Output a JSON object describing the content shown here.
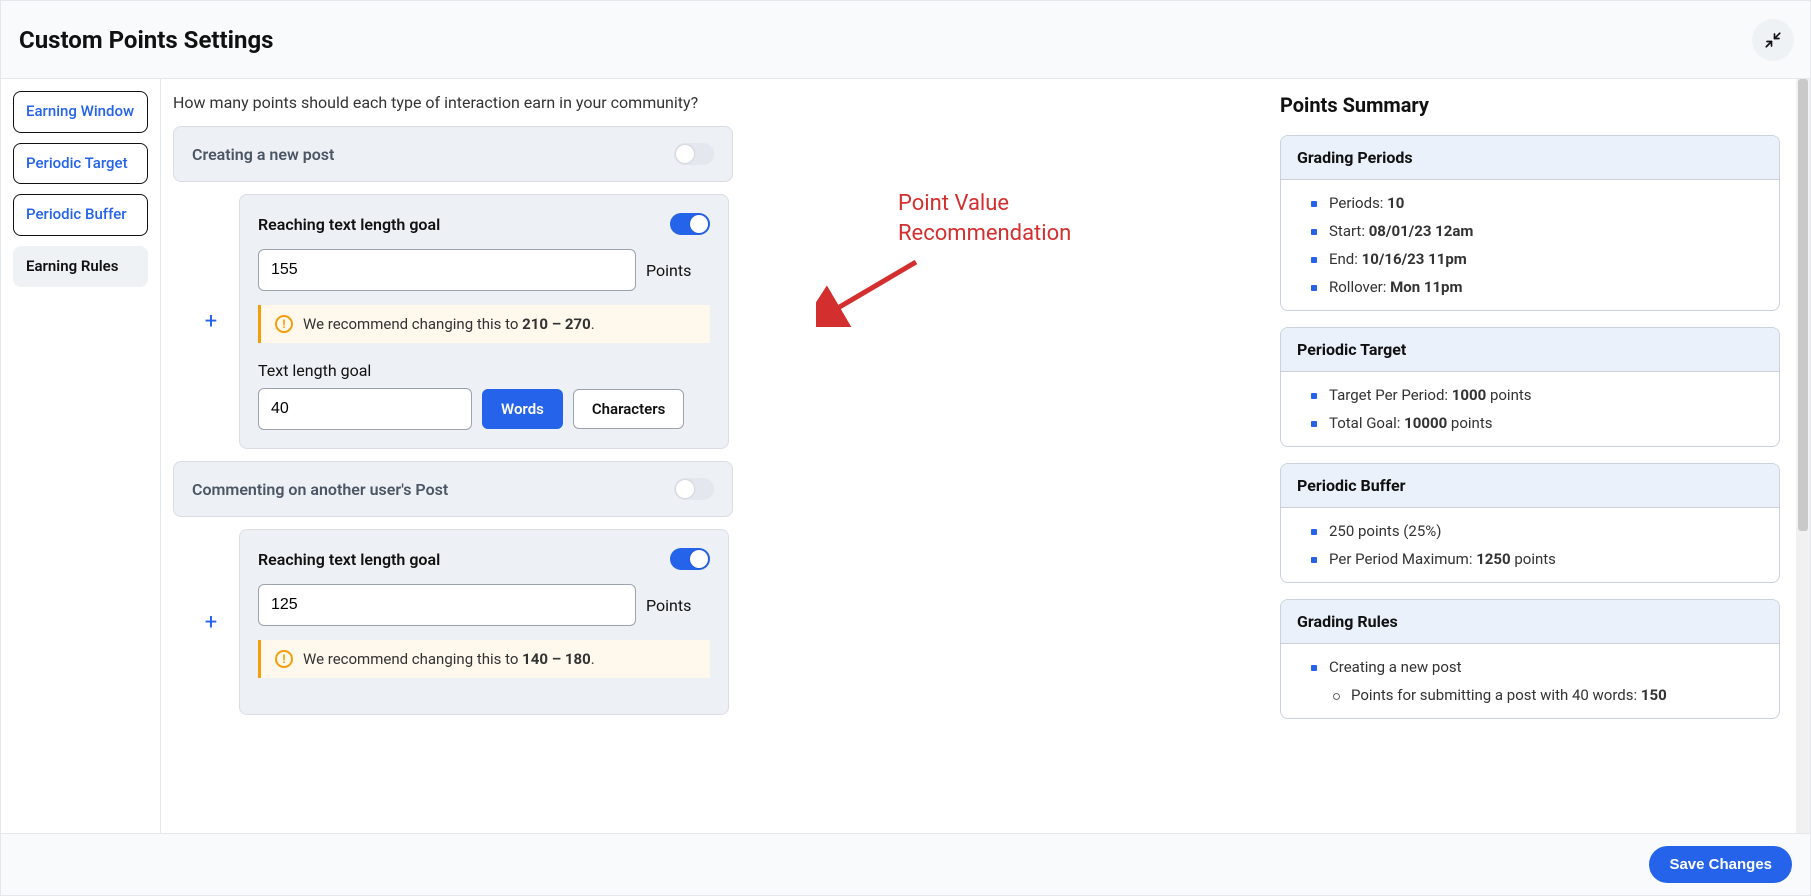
{
  "header": {
    "title": "Custom Points Settings"
  },
  "sidebar": {
    "items": [
      {
        "label": "Earning Window"
      },
      {
        "label": "Periodic Target"
      },
      {
        "label": "Periodic Buffer"
      },
      {
        "label": "Earning Rules"
      }
    ]
  },
  "main": {
    "question": "How many points should each type of interaction earn in your community?",
    "annotation_line1": "Point Value",
    "annotation_line2": "Recommendation",
    "sections": [
      {
        "title": "Creating a new post",
        "nested": {
          "title": "Reaching text length goal",
          "points_value": "155",
          "points_label": "Points",
          "recommend_prefix": "We recommend changing this to ",
          "recommend_bold": "210 – 270",
          "goal_label": "Text length goal",
          "goal_value": "40",
          "unit_words": "Words",
          "unit_chars": "Characters"
        }
      },
      {
        "title": "Commenting on another user's Post",
        "nested": {
          "title": "Reaching text length goal",
          "points_value": "125",
          "points_label": "Points",
          "recommend_prefix": "We recommend changing this to ",
          "recommend_bold": "140 – 180"
        }
      }
    ]
  },
  "summary": {
    "heading": "Points Summary",
    "grading_periods": {
      "title": "Grading Periods",
      "periods_label": "Periods: ",
      "periods_value": "10",
      "start_label": "Start: ",
      "start_value": "08/01/23 12am",
      "end_label": "End: ",
      "end_value": "10/16/23 11pm",
      "rollover_label": "Rollover: ",
      "rollover_value": "Mon 11pm"
    },
    "periodic_target": {
      "title": "Periodic Target",
      "target_label": "Target Per Period: ",
      "target_value": "1000",
      "target_suffix": " points",
      "total_label": "Total Goal: ",
      "total_value": "10000",
      "total_suffix": " points"
    },
    "periodic_buffer": {
      "title": "Periodic Buffer",
      "buffer_text": "250 points (25%)",
      "max_label": "Per Period Maximum: ",
      "max_value": "1250",
      "max_suffix": " points"
    },
    "grading_rules": {
      "title": "Grading Rules",
      "rule1": "Creating a new post",
      "rule1_sub_prefix": "Points for submitting a post with 40 words: ",
      "rule1_sub_value": "150"
    }
  },
  "footer": {
    "save": "Save Changes"
  }
}
